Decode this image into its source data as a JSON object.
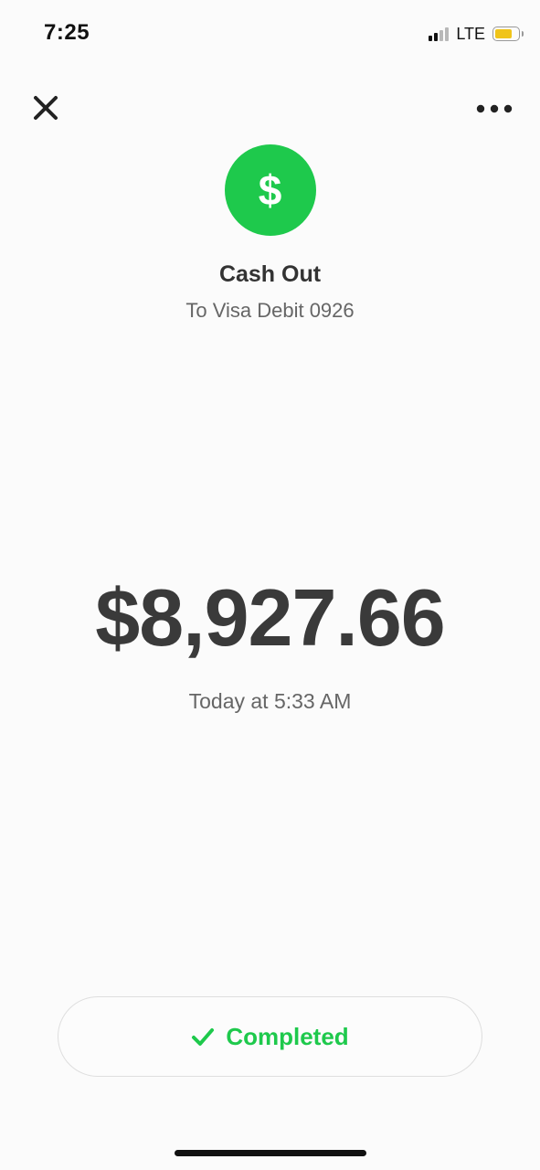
{
  "status_bar": {
    "time": "7:25",
    "network": "LTE",
    "signal_bars_active": 2,
    "battery_color": "#f0c419"
  },
  "nav": {
    "close_icon": "close-icon",
    "more_icon": "ellipsis-icon"
  },
  "header": {
    "logo_icon": "dollar-sign-icon",
    "logo_glyph": "$",
    "logo_color": "#1ec94c",
    "title": "Cash Out",
    "subtitle": "To Visa Debit 0926"
  },
  "transaction": {
    "amount": "$8,927.66",
    "timestamp": "Today at 5:33 AM"
  },
  "status": {
    "icon": "checkmark-icon",
    "label": "Completed",
    "color": "#1ec94c"
  }
}
